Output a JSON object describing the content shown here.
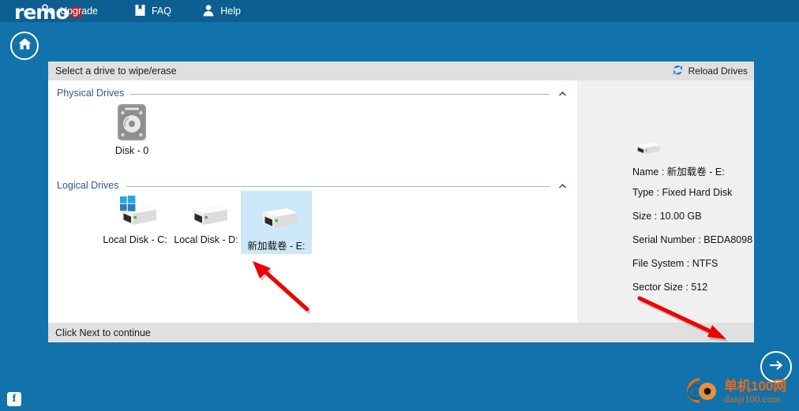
{
  "app": {
    "brand": "remo",
    "brand_square_color": "#c0202b",
    "topbar_color": "#0d5f91",
    "background_color": "#1272ab"
  },
  "topnav": {
    "items": [
      {
        "label": "Upgrade",
        "icon": "key-icon"
      },
      {
        "label": "FAQ",
        "icon": "book-icon"
      },
      {
        "label": "Help",
        "icon": "person-icon"
      }
    ]
  },
  "home_button": {
    "icon": "home-icon",
    "label": "Home"
  },
  "card": {
    "title": "Select a drive to wipe/erase",
    "reload": {
      "label": "Reload Drives",
      "icon": "refresh-icon"
    },
    "status": "Click Next to continue"
  },
  "groups": {
    "physical": {
      "label": "Physical Drives",
      "chevron": "chevron-up-icon"
    },
    "logical": {
      "label": "Logical Drives",
      "chevron": "chevron-up-icon"
    }
  },
  "physical_drives": [
    {
      "label": "Disk - 0",
      "icon": "hard-disk-icon",
      "selected": false
    }
  ],
  "logical_drives": [
    {
      "label": "Local Disk - C:",
      "icon": "drive-icon-windows",
      "selected": false
    },
    {
      "label": "Local Disk - D:",
      "icon": "drive-icon",
      "selected": false
    },
    {
      "label": "新加载卷 - E:",
      "icon": "drive-icon",
      "selected": true
    }
  ],
  "details": {
    "icon": "drive-icon",
    "rows": [
      {
        "label": "Name :",
        "value": "新加载卷 - E:"
      },
      {
        "label": "Type :",
        "value": "Fixed Hard Disk"
      },
      {
        "label": "Size :",
        "value": "10.00 GB"
      },
      {
        "label": "Serial Number :",
        "value": "BEDA8098"
      },
      {
        "label": "File System :",
        "value": "NTFS"
      },
      {
        "label": "Sector Size :",
        "value": "512"
      }
    ],
    "name": "Name : 新加载卷 - E:",
    "type": "Type : Fixed Hard Disk",
    "size": "Size :   10.00 GB",
    "serial": "Serial Number : BEDA8098",
    "filesystem": "File System : NTFS",
    "sector": "Sector Size : 512"
  },
  "next_button": {
    "icon": "arrow-right-icon",
    "label": "Next"
  },
  "facebook_button": {
    "icon": "facebook-icon",
    "label": "f"
  },
  "watermark": {
    "cn": "单机100网",
    "en": "danji100.com",
    "color": "#e86a17"
  },
  "annotations": [
    {
      "name": "arrow-to-e-drive",
      "color": "#ee0000"
    },
    {
      "name": "arrow-to-next-button",
      "color": "#ee0000"
    }
  ]
}
